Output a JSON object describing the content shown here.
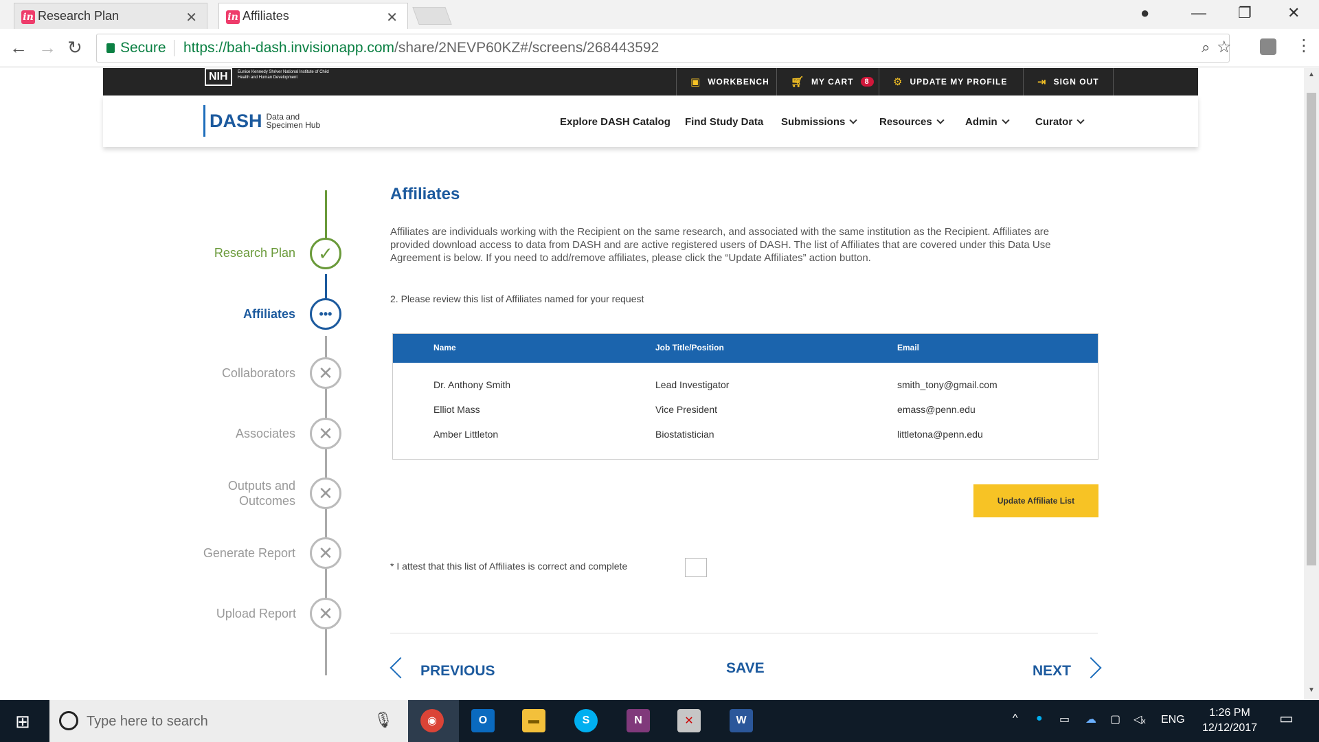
{
  "browser": {
    "tabs": [
      {
        "title": "Research Plan"
      },
      {
        "title": "Affiliates"
      }
    ],
    "address": {
      "secure_label": "Secure",
      "url_host": "https://bah-dash.invisionapp.com",
      "url_path": "/share/2NEVP60KZ#/screens/268443592"
    }
  },
  "topbar": {
    "nih_badge": "NIH",
    "nih_text": "Eunice Kennedy Shriver National Institute of Child Health and Human Development",
    "links": {
      "workbench": "WORKBENCH",
      "cart": "MY CART",
      "cart_count": "8",
      "profile": "UPDATE MY PROFILE",
      "signout": "SIGN OUT"
    }
  },
  "nav": {
    "logo_big": "DASH",
    "logo_small_1": "Data and",
    "logo_small_2": "Specimen Hub",
    "items": {
      "explore": "Explore DASH Catalog",
      "find": "Find Study Data",
      "submissions": "Submissions",
      "resources": "Resources",
      "admin": "Admin",
      "curator": "Curator"
    }
  },
  "steps": {
    "research_plan": "Research Plan",
    "affiliates": "Affiliates",
    "collaborators": "Collaborators",
    "associates": "Associates",
    "outputs_1": "Outputs and",
    "outputs_2": "Outcomes",
    "generate": "Generate Report",
    "upload": "Upload Report"
  },
  "content": {
    "title": "Affiliates",
    "description": "Affiliates are individuals working with the Recipient on the same research, and associated with the same institution as the Recipient. Affiliates are provided download access to data from DASH and are active registered users of DASH. The list of Affiliates that are covered under this Data Use Agreement is below. If you need to add/remove affiliates, please click the “Update Affiliates” action button.",
    "question": "2. Please review this list of Affiliates named for your request",
    "table": {
      "headers": {
        "name": "Name",
        "job": "Job Title/Position",
        "email": "Email"
      },
      "rows": [
        {
          "name": "Dr. Anthony Smith",
          "job": "Lead Investigator",
          "email": "smith_tony@gmail.com"
        },
        {
          "name": "Elliot Mass",
          "job": "Vice President",
          "email": "emass@penn.edu"
        },
        {
          "name": "Amber Littleton",
          "job": "Biostatistician",
          "email": "littletona@penn.edu"
        }
      ]
    },
    "update_button": "Update Affiliate List",
    "attest": "* I attest that this list of Affiliates is correct and complete",
    "previous": "PREVIOUS",
    "save": "SAVE",
    "next": "NEXT"
  },
  "taskbar": {
    "search_placeholder": "Type here to search",
    "lang": "ENG",
    "time": "1:26 PM",
    "date": "12/12/2017"
  },
  "colors": {
    "primary_blue": "#1c5a9e",
    "header_blue": "#1b64ad",
    "accent_yellow": "#f7c325",
    "complete_green": "#6a9a3a"
  }
}
